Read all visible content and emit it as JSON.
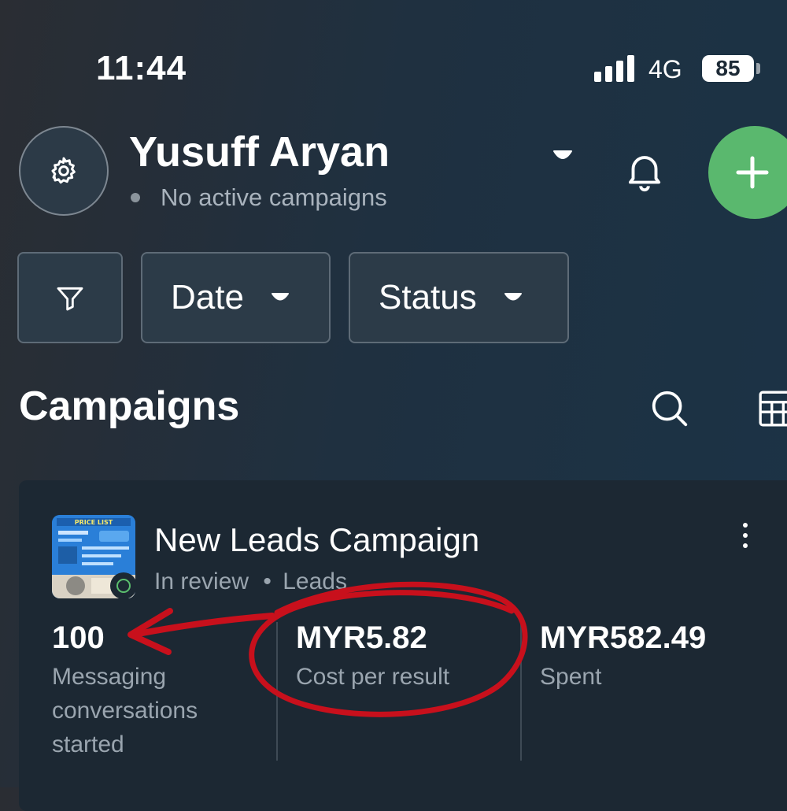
{
  "status_bar": {
    "time": "11:44",
    "network": "4G",
    "battery": "85"
  },
  "header": {
    "account_name": "Yusuff Aryan",
    "campaign_status": "No active campaigns"
  },
  "filters": {
    "date_label": "Date",
    "status_label": "Status"
  },
  "section": {
    "title": "Campaigns"
  },
  "campaign": {
    "name": "New Leads Campaign",
    "review_status": "In review",
    "separator": "•",
    "objective": "Leads",
    "thumbnail_text": "PRICE LIST",
    "metrics": [
      {
        "value": "100",
        "label": "Messaging conversations started"
      },
      {
        "value": "MYR5.82",
        "label": "Cost per result"
      },
      {
        "value": "MYR582.49",
        "label": "Spent"
      }
    ]
  },
  "colors": {
    "accent_green": "#5ab86e",
    "annotation_red": "#c8101c",
    "background": "#1f3040",
    "card": "#1c2833"
  },
  "icons": [
    "gear-icon",
    "caret-down-icon",
    "bell-icon",
    "plus-icon",
    "filter-icon",
    "search-icon",
    "table-icon",
    "more-vertical-icon",
    "status-ring-icon"
  ]
}
